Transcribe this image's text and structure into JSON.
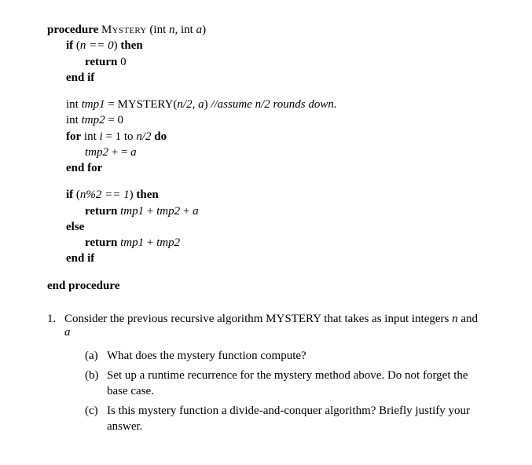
{
  "proc": {
    "kw_procedure": "procedure",
    "name_caps": "Mystery",
    "sig_open": "(int ",
    "n": "n",
    "sig_mid": ", int ",
    "a": "a",
    "sig_close": ")",
    "kw_if": "if",
    "cond1_open": " (",
    "cond1_body": "n == 0",
    "cond1_close": ") ",
    "kw_then": "then",
    "kw_return": "return",
    "zero": " 0",
    "kw_endif": "end if",
    "line_tmp1_a": "int ",
    "tmp1": "tmp1",
    "line_tmp1_b": " = MYSTERY(",
    "line_tmp1_c": "n/2, a",
    "line_tmp1_d": ") ",
    "comment1": "//assume n/2 rounds down.",
    "line_tmp2_a": "int ",
    "tmp2": "tmp2",
    "line_tmp2_b": " = 0",
    "kw_for": "for",
    "for_body_a": " int ",
    "i": "i",
    "for_body_b": " = 1 to ",
    "for_body_c": "n/2",
    "kw_do": " do",
    "loop_body": " + = ",
    "kw_endfor": "end for",
    "cond2_open": " (",
    "cond2_body": "n%2 == 1",
    "cond2_close": ") ",
    "ret2": " + ",
    "ret2b": " + ",
    "kw_else": "else",
    "ret3": " + ",
    "kw_endproc": "end procedure"
  },
  "q": {
    "num": "1.",
    "text_a": "Consider the previous recursive algorithm MYSTERY that takes as input integers ",
    "text_b": " and ",
    "a": {
      "label": "(a)",
      "text": "What does the mystery function compute?"
    },
    "b": {
      "label": "(b)",
      "text": "Set up a runtime recurrence for the mystery method above. Do not forget the base case."
    },
    "c": {
      "label": "(c)",
      "text": "Is this mystery function a divide-and-conquer algorithm? Briefly justify your answer."
    }
  }
}
